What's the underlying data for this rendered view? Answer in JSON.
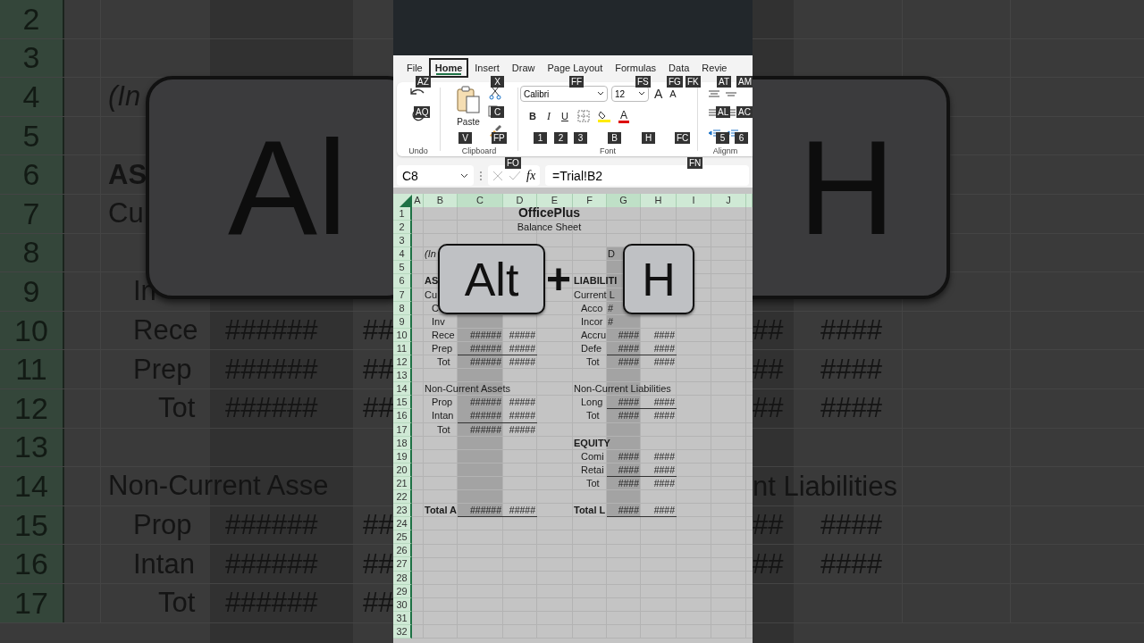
{
  "backdrop": {
    "left_key": "Al",
    "right_key": "H",
    "rows": [
      {
        "number": "2"
      },
      {
        "number": "3"
      },
      {
        "number": "4",
        "label": "(In",
        "kind": "italic"
      },
      {
        "number": "5"
      },
      {
        "number": "6",
        "label": "AS",
        "kind": "bold"
      },
      {
        "number": "7",
        "label": "Cu",
        "kind": "plain"
      },
      {
        "number": "8"
      },
      {
        "number": "9",
        "label": "In",
        "kind": "indent"
      },
      {
        "number": "10",
        "label": "Rece",
        "kind": "indent",
        "value_1": "######",
        "value_2": "##",
        "right_value_1": "##",
        "right_value_2": "####"
      },
      {
        "number": "11",
        "label": "Prep",
        "kind": "indent",
        "value_1": "######",
        "value_2": "##",
        "right_value_1": "##",
        "right_value_2": "####"
      },
      {
        "number": "12",
        "label": "Tot",
        "kind": "total",
        "value_1": "######",
        "value_2": "##",
        "right_value_1": "##",
        "right_value_2": "####"
      },
      {
        "number": "13"
      },
      {
        "number": "14",
        "label": "Non-Current Asse",
        "kind": "plain",
        "right_label": "nt Liabilities"
      },
      {
        "number": "15",
        "label": "Prop",
        "kind": "indent",
        "value_1": "######",
        "value_2": "##",
        "right_value_1": "##",
        "right_value_2": "####"
      },
      {
        "number": "16",
        "label": "Intan",
        "kind": "indent",
        "value_1": "######",
        "value_2": "##",
        "right_value_1": "##",
        "right_value_2": "####"
      },
      {
        "number": "17",
        "label": "Tot",
        "kind": "total",
        "value_1": "######",
        "value_2": "##"
      }
    ]
  },
  "excel": {
    "tabs": [
      {
        "label": "File",
        "selected": false
      },
      {
        "label": "Home",
        "selected": true
      },
      {
        "label": "Insert",
        "selected": false
      },
      {
        "label": "Draw",
        "selected": false
      },
      {
        "label": "Page Layout",
        "selected": false
      },
      {
        "label": "Formulas",
        "selected": false
      },
      {
        "label": "Data",
        "selected": false
      },
      {
        "label": "Revie",
        "selected": false
      }
    ],
    "ribbon": {
      "undo": {
        "label": "Undo"
      },
      "clipboard": {
        "label": "Clipboard",
        "paste": "Paste"
      },
      "font": {
        "label": "Font",
        "font_name": "Calibri",
        "font_size": "12",
        "grow": "A",
        "shrink": "A",
        "bold": "B",
        "italic": "I",
        "underline": "U",
        "font_color": "A"
      },
      "alignment": {
        "label": "Alignm"
      }
    },
    "keytips": [
      "AZ",
      "X",
      "FF",
      "FS",
      "FG",
      "FK",
      "AT",
      "AM",
      "AQ",
      "C",
      "AL",
      "AC",
      "V",
      "FP",
      "1",
      "2",
      "3",
      "B",
      "H",
      "FC",
      "5",
      "6",
      "FO",
      "FN"
    ],
    "name_box": "C8",
    "fx": "fx",
    "formula": "=Trial!B2",
    "columns": [
      {
        "label": "A",
        "shaded": false
      },
      {
        "label": "B",
        "shaded": false
      },
      {
        "label": "C",
        "shaded": true
      },
      {
        "label": "D",
        "shaded": false
      },
      {
        "label": "E",
        "shaded": false
      },
      {
        "label": "F",
        "shaded": false
      },
      {
        "label": "G",
        "shaded": true
      },
      {
        "label": "H",
        "shaded": false
      },
      {
        "label": "I",
        "shaded": false
      },
      {
        "label": "J",
        "shaded": false
      }
    ],
    "rows": [
      {
        "number": "1",
        "title": {
          "text": "OfficePlus",
          "kind": "bold"
        }
      },
      {
        "number": "2",
        "title": {
          "text": "Balance Sheet",
          "kind": "plain"
        }
      },
      {
        "number": "3"
      },
      {
        "number": "4",
        "b": {
          "text": "(In",
          "kind": "italic"
        },
        "g": {
          "text": "D",
          "kind": "plain"
        }
      },
      {
        "number": "5"
      },
      {
        "number": "6",
        "b": {
          "text": "AS",
          "kind": "bold"
        },
        "f": {
          "text": "LIABILITI",
          "kind": "bold"
        }
      },
      {
        "number": "7",
        "b": {
          "text": "Cu",
          "kind": "plain"
        },
        "f": {
          "text": "Current L",
          "kind": "plain"
        }
      },
      {
        "number": "8",
        "b": {
          "text": "C",
          "kind": "indent"
        },
        "f": {
          "text": "Acco",
          "kind": "indent"
        },
        "g": {
          "text": "#",
          "kind": "plain"
        }
      },
      {
        "number": "9",
        "b": {
          "text": "Inv",
          "kind": "indent"
        },
        "f": {
          "text": "Incor",
          "kind": "indent"
        },
        "g": {
          "text": "#",
          "kind": "plain"
        }
      },
      {
        "number": "10",
        "b": {
          "text": "Rece",
          "kind": "indent"
        },
        "c": {
          "text": "######",
          "kind": "number"
        },
        "d": {
          "text": "#####",
          "kind": "number"
        },
        "f": {
          "text": "Accru",
          "kind": "indent"
        },
        "g": {
          "text": "####",
          "kind": "number"
        },
        "h": {
          "text": "####",
          "kind": "number"
        }
      },
      {
        "number": "11",
        "b": {
          "text": "Prep",
          "kind": "indent"
        },
        "c": {
          "text": "######",
          "kind": "number"
        },
        "d": {
          "text": "#####",
          "kind": "number"
        },
        "f": {
          "text": "Defe",
          "kind": "indent"
        },
        "g": {
          "text": "####",
          "kind": "number"
        },
        "h": {
          "text": "####",
          "kind": "number"
        },
        "rule_left": true,
        "rule_right": true
      },
      {
        "number": "12",
        "b": {
          "text": "Tot",
          "kind": "total"
        },
        "c": {
          "text": "######",
          "kind": "number"
        },
        "d": {
          "text": "#####",
          "kind": "number"
        },
        "f": {
          "text": "Tot",
          "kind": "total"
        },
        "g": {
          "text": "####",
          "kind": "number"
        },
        "h": {
          "text": "####",
          "kind": "number"
        }
      },
      {
        "number": "13"
      },
      {
        "number": "14",
        "b": {
          "text": "Non-Current Assets",
          "kind": "plain"
        },
        "f": {
          "text": "Non-Current Liabilities",
          "kind": "plain"
        }
      },
      {
        "number": "15",
        "b": {
          "text": "Prop",
          "kind": "indent"
        },
        "c": {
          "text": "######",
          "kind": "number"
        },
        "d": {
          "text": "#####",
          "kind": "number"
        },
        "f": {
          "text": "Long",
          "kind": "indent"
        },
        "g": {
          "text": "####",
          "kind": "number"
        },
        "h": {
          "text": "####",
          "kind": "number"
        },
        "rule_right": true
      },
      {
        "number": "16",
        "b": {
          "text": "Intan",
          "kind": "indent"
        },
        "c": {
          "text": "######",
          "kind": "number"
        },
        "d": {
          "text": "#####",
          "kind": "number"
        },
        "f": {
          "text": "Tot",
          "kind": "total"
        },
        "g": {
          "text": "####",
          "kind": "number"
        },
        "h": {
          "text": "####",
          "kind": "number"
        },
        "rule_left": true
      },
      {
        "number": "17",
        "b": {
          "text": "Tot",
          "kind": "total"
        },
        "c": {
          "text": "######",
          "kind": "number"
        },
        "d": {
          "text": "#####",
          "kind": "number"
        }
      },
      {
        "number": "18",
        "f": {
          "text": "EQUITY",
          "kind": "bold"
        }
      },
      {
        "number": "19",
        "f": {
          "text": "Comi",
          "kind": "indent"
        },
        "g": {
          "text": "####",
          "kind": "number"
        },
        "h": {
          "text": "####",
          "kind": "number"
        }
      },
      {
        "number": "20",
        "f": {
          "text": "Retai",
          "kind": "indent"
        },
        "g": {
          "text": "####",
          "kind": "number"
        },
        "h": {
          "text": "####",
          "kind": "number"
        },
        "rule_right": true
      },
      {
        "number": "21",
        "f": {
          "text": "Tot",
          "kind": "total"
        },
        "g": {
          "text": "####",
          "kind": "number"
        },
        "h": {
          "text": "####",
          "kind": "number"
        }
      },
      {
        "number": "22"
      },
      {
        "number": "23",
        "b": {
          "text": "Total A",
          "kind": "bold"
        },
        "c": {
          "text": "######",
          "kind": "number"
        },
        "d": {
          "text": "#####",
          "kind": "number"
        },
        "f": {
          "text": "Total L",
          "kind": "bold"
        },
        "g": {
          "text": "####",
          "kind": "number"
        },
        "h": {
          "text": "####",
          "kind": "number"
        },
        "rule_left": true,
        "rule_right": true
      },
      {
        "number": "24"
      },
      {
        "number": "25"
      },
      {
        "number": "26"
      },
      {
        "number": "27"
      },
      {
        "number": "28"
      },
      {
        "number": "29"
      },
      {
        "number": "30"
      },
      {
        "number": "31"
      },
      {
        "number": "32"
      }
    ]
  },
  "shortcut": {
    "keys": [
      "Alt",
      "H"
    ],
    "joiner": "+"
  }
}
